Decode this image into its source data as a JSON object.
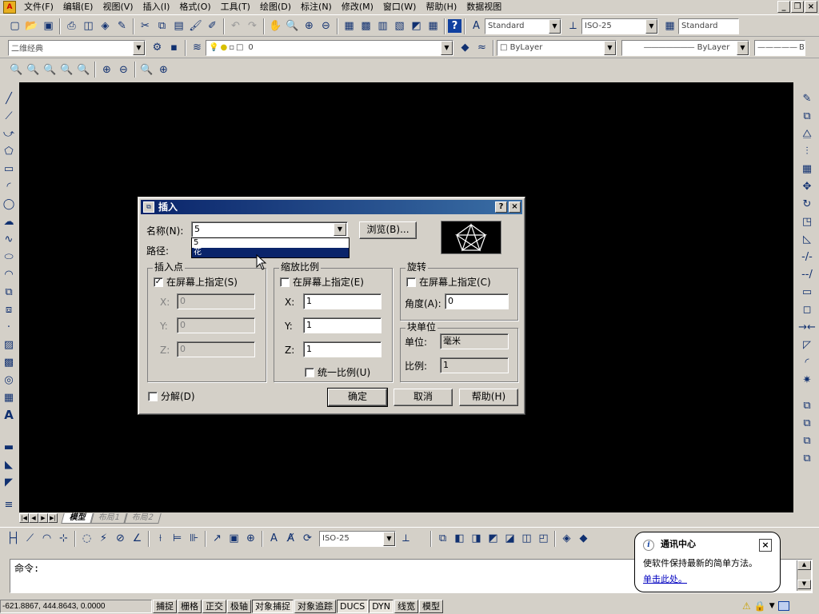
{
  "menu": [
    "文件(F)",
    "编辑(E)",
    "视图(V)",
    "插入(I)",
    "格式(O)",
    "工具(T)",
    "绘图(D)",
    "标注(N)",
    "修改(M)",
    "窗口(W)",
    "帮助(H)",
    "数据视图"
  ],
  "app_icon_glyph": "A",
  "window_buttons": {
    "minimize": "_",
    "restore": "❐",
    "close": "×"
  },
  "toolbar1": {
    "text_style": "Standard",
    "dim_style": "ISO-25",
    "table_style": "Standard"
  },
  "toolbar2": {
    "workspace": "二维经典",
    "layer": "0",
    "color": "ByLayer",
    "linetype": "ByLayer",
    "lineweight": "ByL"
  },
  "bottom_toolbar": {
    "dim_style": "ISO-25"
  },
  "layout_tabs": [
    "模型",
    "布局1",
    "布局2"
  ],
  "command": {
    "prompt": "命令:"
  },
  "status": {
    "coords": "-621.8867, 444.8643, 0.0000",
    "toggles": [
      {
        "label": "捕捉",
        "on": false
      },
      {
        "label": "栅格",
        "on": false
      },
      {
        "label": "正交",
        "on": false
      },
      {
        "label": "极轴",
        "on": false
      },
      {
        "label": "对象捕捉",
        "on": true
      },
      {
        "label": "对象追踪",
        "on": false
      },
      {
        "label": "DUCS",
        "on": true
      },
      {
        "label": "DYN",
        "on": true
      },
      {
        "label": "线宽",
        "on": false
      },
      {
        "label": "模型",
        "on": false
      }
    ]
  },
  "bubble": {
    "title": "通讯中心",
    "message": "使软件保持最新的简单方法。",
    "link": "单击此处。",
    "info": "i",
    "close": "×"
  },
  "dialog": {
    "title": "插入",
    "help_btn": "?",
    "close_btn": "×",
    "name_label": "名称(N):",
    "name_value": "5",
    "dropdown_options": [
      "5",
      "花"
    ],
    "browse_label": "浏览(B)...",
    "path_label": "路径:",
    "insertion": {
      "title": "插入点",
      "on_screen": "在屏幕上指定(S)",
      "on_screen_checked": true,
      "x_label": "X:",
      "x": "0",
      "y_label": "Y:",
      "y": "0",
      "z_label": "Z:",
      "z": "0"
    },
    "scale": {
      "title": "缩放比例",
      "on_screen": "在屏幕上指定(E)",
      "on_screen_checked": false,
      "x_label": "X:",
      "x": "1",
      "y_label": "Y:",
      "y": "1",
      "z_label": "Z:",
      "z": "1",
      "uniform": "统一比例(U)",
      "uniform_checked": false
    },
    "rotation": {
      "title": "旋转",
      "on_screen": "在屏幕上指定(C)",
      "on_screen_checked": false,
      "angle_label": "角度(A):",
      "angle": "0"
    },
    "block_unit": {
      "title": "块单位",
      "unit_label": "单位:",
      "unit": "毫米",
      "factor_label": "比例:",
      "factor": "1"
    },
    "explode": "分解(D)",
    "explode_checked": false,
    "ok": "确定",
    "cancel": "取消",
    "help": "帮助(H)"
  }
}
